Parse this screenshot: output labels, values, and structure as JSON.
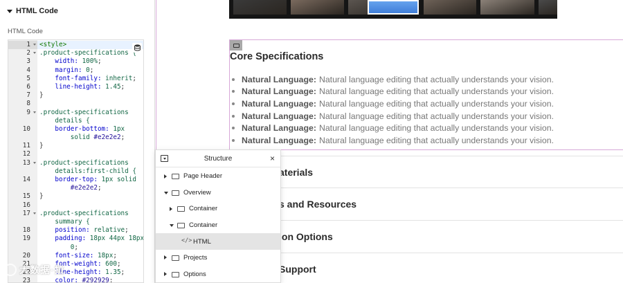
{
  "left_panel": {
    "section_title": "HTML Code",
    "field_label": "HTML Code",
    "code": [
      {
        "n": "1",
        "fold": true,
        "active": true,
        "parts": [
          [
            "tag",
            "<style>"
          ]
        ]
      },
      {
        "n": "2",
        "fold": true,
        "parts": [
          [
            "sel",
            ".product-specifications {"
          ]
        ]
      },
      {
        "n": "3",
        "parts": [
          [
            "prop",
            "    width: "
          ],
          [
            "num",
            "100%"
          ],
          [
            "plain",
            ";"
          ]
        ]
      },
      {
        "n": "4",
        "parts": [
          [
            "prop",
            "    margin: "
          ],
          [
            "num",
            "0"
          ],
          [
            "plain",
            ";"
          ]
        ]
      },
      {
        "n": "5",
        "parts": [
          [
            "prop",
            "    font-family: "
          ],
          [
            "val",
            "inherit"
          ],
          [
            "plain",
            ";"
          ]
        ]
      },
      {
        "n": "6",
        "parts": [
          [
            "prop",
            "    line-height: "
          ],
          [
            "num",
            "1.45"
          ],
          [
            "plain",
            ";"
          ]
        ]
      },
      {
        "n": "7",
        "parts": [
          [
            "plain",
            "}"
          ]
        ]
      },
      {
        "n": "8",
        "parts": [
          [
            "plain",
            ""
          ]
        ]
      },
      {
        "n": "9",
        "fold": true,
        "parts": [
          [
            "sel",
            ".product-specifications"
          ]
        ]
      },
      {
        "n": "",
        "parts": [
          [
            "sel",
            "    details {"
          ]
        ]
      },
      {
        "n": "10",
        "parts": [
          [
            "prop",
            "    border-bottom: "
          ],
          [
            "num",
            "1px"
          ]
        ]
      },
      {
        "n": "",
        "parts": [
          [
            "val",
            "        solid "
          ],
          [
            "str",
            "#e2e2e2"
          ],
          [
            "plain",
            ";"
          ]
        ]
      },
      {
        "n": "11",
        "parts": [
          [
            "plain",
            "}"
          ]
        ]
      },
      {
        "n": "12",
        "parts": [
          [
            "plain",
            ""
          ]
        ]
      },
      {
        "n": "13",
        "fold": true,
        "parts": [
          [
            "sel",
            ".product-specifications"
          ]
        ]
      },
      {
        "n": "",
        "parts": [
          [
            "sel",
            "    details:first-child {"
          ]
        ]
      },
      {
        "n": "14",
        "parts": [
          [
            "prop",
            "    border-top: "
          ],
          [
            "num",
            "1px "
          ],
          [
            "val",
            "solid"
          ]
        ]
      },
      {
        "n": "",
        "parts": [
          [
            "str",
            "        #e2e2e2"
          ],
          [
            "plain",
            ";"
          ]
        ]
      },
      {
        "n": "15",
        "parts": [
          [
            "plain",
            "}"
          ]
        ]
      },
      {
        "n": "16",
        "parts": [
          [
            "plain",
            ""
          ]
        ]
      },
      {
        "n": "17",
        "fold": true,
        "parts": [
          [
            "sel",
            ".product-specifications"
          ]
        ]
      },
      {
        "n": "",
        "parts": [
          [
            "sel",
            "    summary {"
          ]
        ]
      },
      {
        "n": "18",
        "parts": [
          [
            "prop",
            "    position: "
          ],
          [
            "val",
            "relative"
          ],
          [
            "plain",
            ";"
          ]
        ]
      },
      {
        "n": "19",
        "parts": [
          [
            "prop",
            "    padding: "
          ],
          [
            "num",
            "18px 44px 18px"
          ]
        ]
      },
      {
        "n": "",
        "parts": [
          [
            "num",
            "        0"
          ],
          [
            "plain",
            ";"
          ]
        ]
      },
      {
        "n": "20",
        "parts": [
          [
            "prop",
            "    font-size: "
          ],
          [
            "num",
            "18px"
          ],
          [
            "plain",
            ";"
          ]
        ]
      },
      {
        "n": "21",
        "parts": [
          [
            "prop",
            "    font-weight: "
          ],
          [
            "num",
            "600"
          ],
          [
            "plain",
            ";"
          ]
        ]
      },
      {
        "n": "22",
        "parts": [
          [
            "prop",
            "    line-height: "
          ],
          [
            "num",
            "1.35"
          ],
          [
            "plain",
            ";"
          ]
        ]
      },
      {
        "n": "23",
        "parts": [
          [
            "prop",
            "    color: "
          ],
          [
            "str",
            "#292929"
          ],
          [
            "plain",
            ";"
          ]
        ]
      }
    ]
  },
  "canvas": {
    "section_title": "Core Specifications",
    "spec_items": [
      {
        "label": "Natural Language:",
        "text": "Natural language editing that actually understands your vision."
      },
      {
        "label": "Natural Language:",
        "text": "Natural language editing that actually understands your vision."
      },
      {
        "label": "Natural Language:",
        "text": "Natural language editing that actually understands your vision."
      },
      {
        "label": "Natural Language:",
        "text": "Natural language editing that actually understands your vision."
      },
      {
        "label": "Natural Language:",
        "text": "Natural language editing that actually understands your vision."
      },
      {
        "label": "Natural Language:",
        "text": "Natural language editing that actually understands your vision."
      }
    ],
    "accordion": [
      {
        "text": "aterials"
      },
      {
        "text": "s and Resources"
      },
      {
        "text": "ion Options"
      },
      {
        "text": "Support"
      }
    ],
    "thumbnails": [
      "#3a3a3a",
      "#7a6a5e",
      "#5b5550",
      "#3c7bd6",
      "#6e6258",
      "#8b8178",
      "#4a4a4a"
    ]
  },
  "structure": {
    "title": "Structure",
    "close": "×",
    "items": [
      {
        "label": "Page Header",
        "depth": 0,
        "arrow": "right",
        "icon": "box"
      },
      {
        "label": "Overview",
        "depth": 0,
        "arrow": "down",
        "icon": "box"
      },
      {
        "label": "Container",
        "depth": 1,
        "arrow": "right",
        "icon": "box"
      },
      {
        "label": "Container",
        "depth": 1,
        "arrow": "down",
        "icon": "box"
      },
      {
        "label": "HTML",
        "depth": 2,
        "arrow": "",
        "icon": "code",
        "highlighted": true
      },
      {
        "label": "Projects",
        "depth": 0,
        "arrow": "right",
        "icon": "box"
      },
      {
        "label": "Options",
        "depth": 0,
        "arrow": "right",
        "icon": "box"
      }
    ]
  },
  "watermark": {
    "text": "大数据·拉"
  },
  "colors": {
    "selection_outline": "#d7a8d8",
    "accent_blue": "#3c7bd6",
    "highlight_row": "#e4e4e4"
  }
}
